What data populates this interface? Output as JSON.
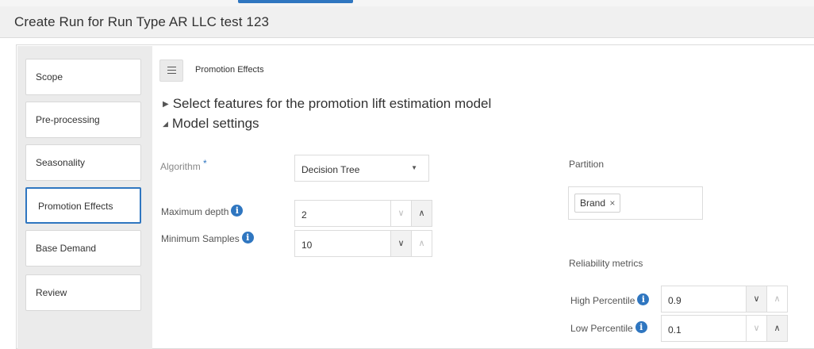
{
  "page": {
    "title": "Create Run for Run Type AR LLC test 123"
  },
  "nav": {
    "items": [
      {
        "label": "Scope"
      },
      {
        "label": "Pre-processing"
      },
      {
        "label": "Seasonality"
      },
      {
        "label": "Promotion Effects",
        "active": true
      },
      {
        "label": "Base Demand"
      },
      {
        "label": "Review"
      }
    ]
  },
  "main": {
    "section_label": "Promotion Effects",
    "disclosures": {
      "features": "Select features for the promotion lift estimation model",
      "model_settings": "Model settings"
    },
    "algorithm": {
      "label": "Algorithm",
      "required_marker": "*",
      "value": "Decision Tree"
    },
    "max_depth": {
      "label": "Maximum depth",
      "value": "2"
    },
    "min_samples": {
      "label": "Minimum Samples",
      "value": "10"
    },
    "partition": {
      "label": "Partition",
      "chip_label": "Brand",
      "chip_remove": "×"
    },
    "reliability": {
      "label": "Reliability metrics",
      "high_percentile": {
        "label": "High Percentile",
        "value": "0.9"
      },
      "low_percentile": {
        "label": "Low Percentile",
        "value": "0.1"
      }
    }
  },
  "colors": {
    "accent": "#2f76c0",
    "nav_background": "#ebebeb",
    "title_bar_background": "#f0f0f0"
  },
  "icons": {
    "menu": "hamburger-menu-icon",
    "info": "info-icon",
    "collapsed": "triangle-right-icon",
    "expanded": "triangle-down-icon",
    "dropdown": "caret-down-icon",
    "decrement": "chevron-down-icon",
    "increment": "chevron-up-icon",
    "remove": "close-icon"
  }
}
